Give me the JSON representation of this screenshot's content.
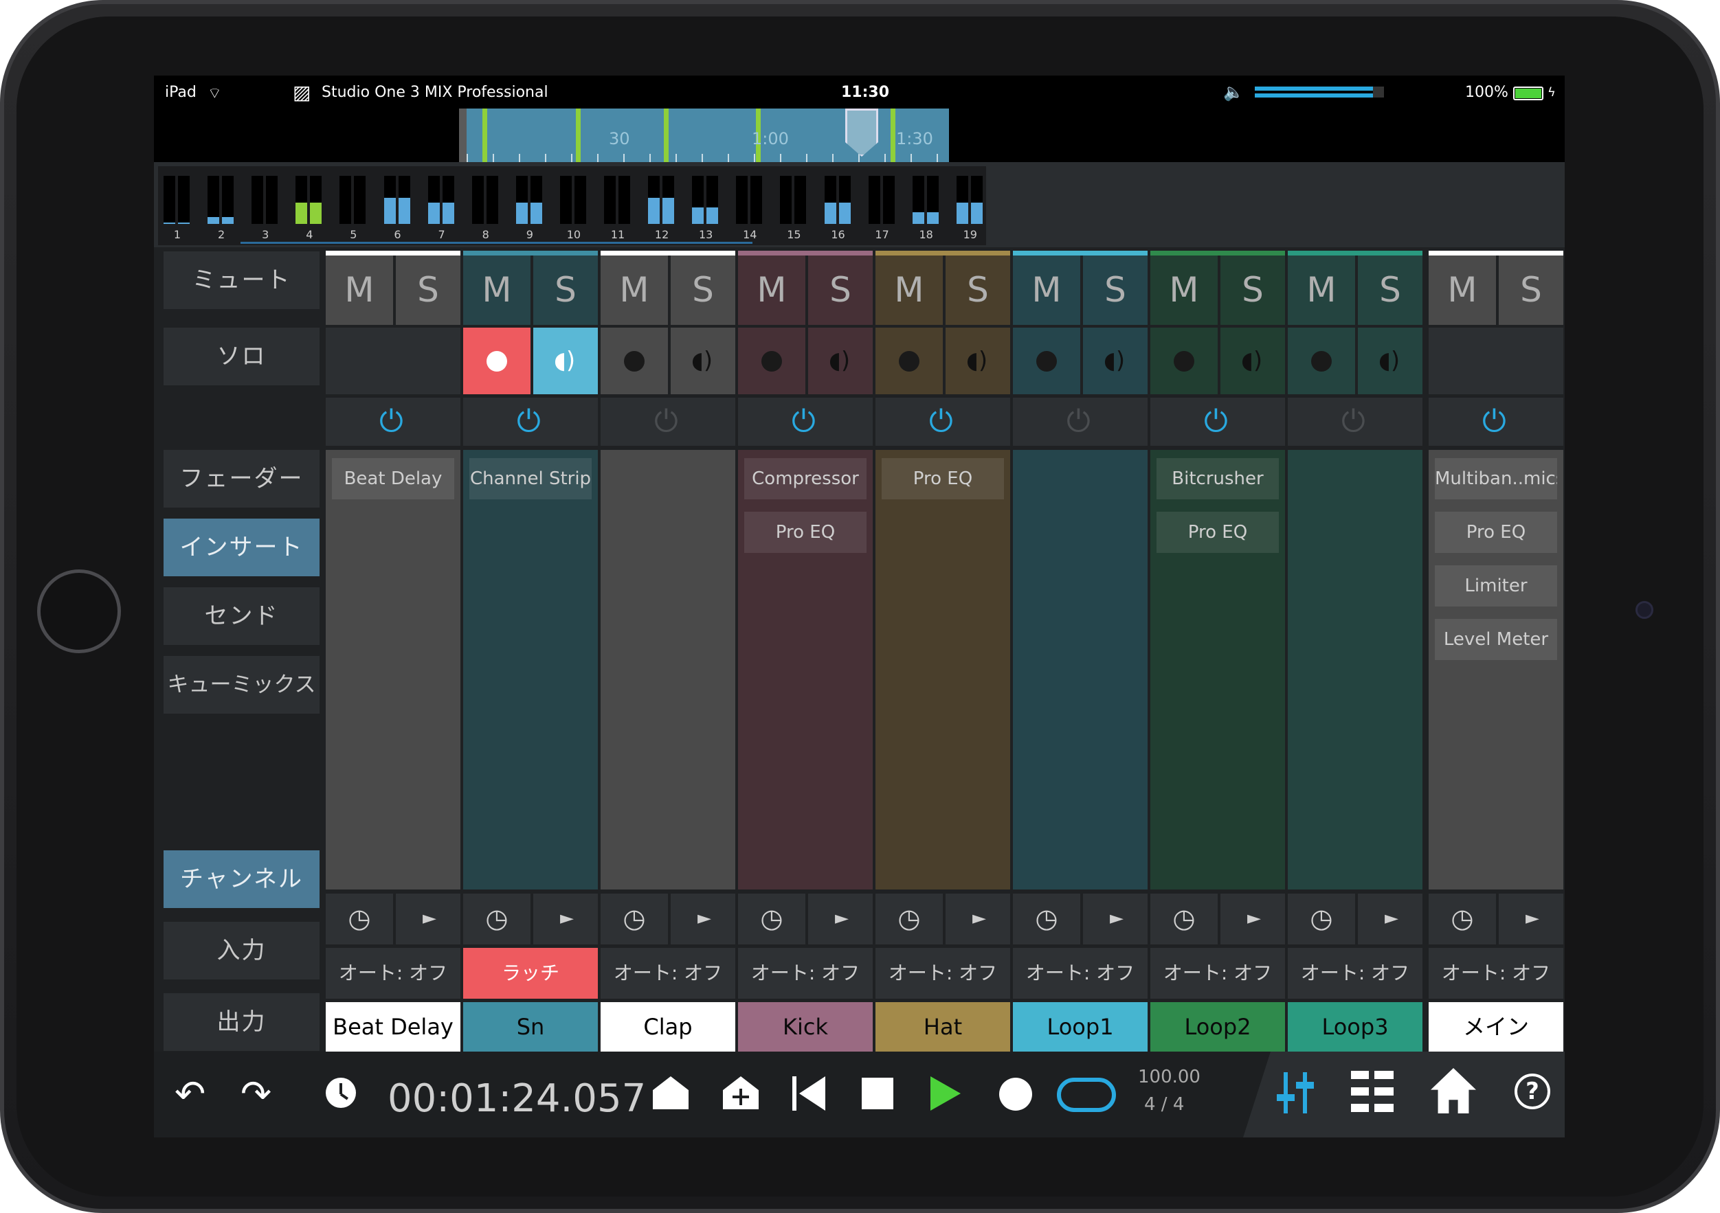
{
  "status": {
    "device": "iPad",
    "app_title": "Studio One 3 MIX Professional",
    "time": "11:30",
    "battery": "100%"
  },
  "timeline": {
    "marks": [
      "30",
      "1:00",
      "1:30"
    ]
  },
  "meters": {
    "labels": [
      "1",
      "2",
      "3",
      "4",
      "5",
      "6",
      "7",
      "8",
      "9",
      "10",
      "11",
      "12",
      "13",
      "14",
      "15",
      "16",
      "17",
      "18",
      "19"
    ]
  },
  "nav": {
    "mute": "ミュート",
    "solo": "ソロ",
    "fader": "フェーダー",
    "insert": "インサート",
    "send": "センド",
    "cuemix": "キューミックス",
    "channel": "チャンネル",
    "input": "入力",
    "output": "出力"
  },
  "ms": {
    "m": "M",
    "s": "S"
  },
  "channels": [
    {
      "name": "Beat Delay",
      "color": "#ffffff",
      "text_color": "#000000",
      "body": "#4a4a4a",
      "inserts": [
        "Beat Delay"
      ],
      "auto": "オート: オフ",
      "armed": false,
      "monitor": false,
      "has_rec": false,
      "power_on": true
    },
    {
      "name": "Sn",
      "color": "#3f8fa3",
      "text_color": "#0a0a0a",
      "body": "#264449",
      "inserts": [
        "Channel Strip"
      ],
      "auto": "ラッチ",
      "armed": true,
      "monitor": true,
      "has_rec": true,
      "power_on": true
    },
    {
      "name": "Clap",
      "color": "#ffffff",
      "text_color": "#000000",
      "body": "#4a4a4a",
      "inserts": [],
      "auto": "オート: オフ",
      "armed": false,
      "monitor": false,
      "has_rec": true,
      "power_on": false
    },
    {
      "name": "Kick",
      "color": "#9a6a82",
      "text_color": "#0a0a0a",
      "body": "#463036",
      "inserts": [
        "Compressor",
        "Pro EQ"
      ],
      "auto": "オート: オフ",
      "armed": false,
      "monitor": false,
      "has_rec": true,
      "power_on": true
    },
    {
      "name": "Hat",
      "color": "#a38a4a",
      "text_color": "#0a0a0a",
      "body": "#4a3f2c",
      "inserts": [
        "Pro EQ"
      ],
      "auto": "オート: オフ",
      "armed": false,
      "monitor": false,
      "has_rec": true,
      "power_on": true
    },
    {
      "name": "Loop1",
      "color": "#46b5d0",
      "text_color": "#0a0a0a",
      "body": "#25454c",
      "inserts": [],
      "auto": "オート: オフ",
      "armed": false,
      "monitor": false,
      "has_rec": true,
      "power_on": false
    },
    {
      "name": "Loop2",
      "color": "#2f8a4c",
      "text_color": "#0a0a0a",
      "body": "#213e31",
      "inserts": [
        "Bitcrusher",
        "Pro EQ"
      ],
      "auto": "オート: オフ",
      "armed": false,
      "monitor": false,
      "has_rec": true,
      "power_on": true
    },
    {
      "name": "Loop3",
      "color": "#2a9a80",
      "text_color": "#0a0a0a",
      "body": "#244440",
      "inserts": [],
      "auto": "オート: オフ",
      "armed": false,
      "monitor": false,
      "has_rec": true,
      "power_on": false
    },
    {
      "name": "メイン",
      "color": "#ffffff",
      "text_color": "#000000",
      "body": "#4a4a4a",
      "inserts": [
        "Multiban..mics",
        "Pro EQ",
        "Limiter",
        "Level Meter"
      ],
      "auto": "オート: オフ",
      "armed": false,
      "monitor": false,
      "has_rec": false,
      "power_on": true
    }
  ],
  "transport": {
    "time": "00:01:24.057",
    "tempo": "100.00",
    "signature": "4 / 4"
  },
  "colors": {
    "accent": "#29a9e0",
    "record": "#ee5a5f",
    "play": "#4cd23a",
    "monitor": "#5ab8d6"
  }
}
